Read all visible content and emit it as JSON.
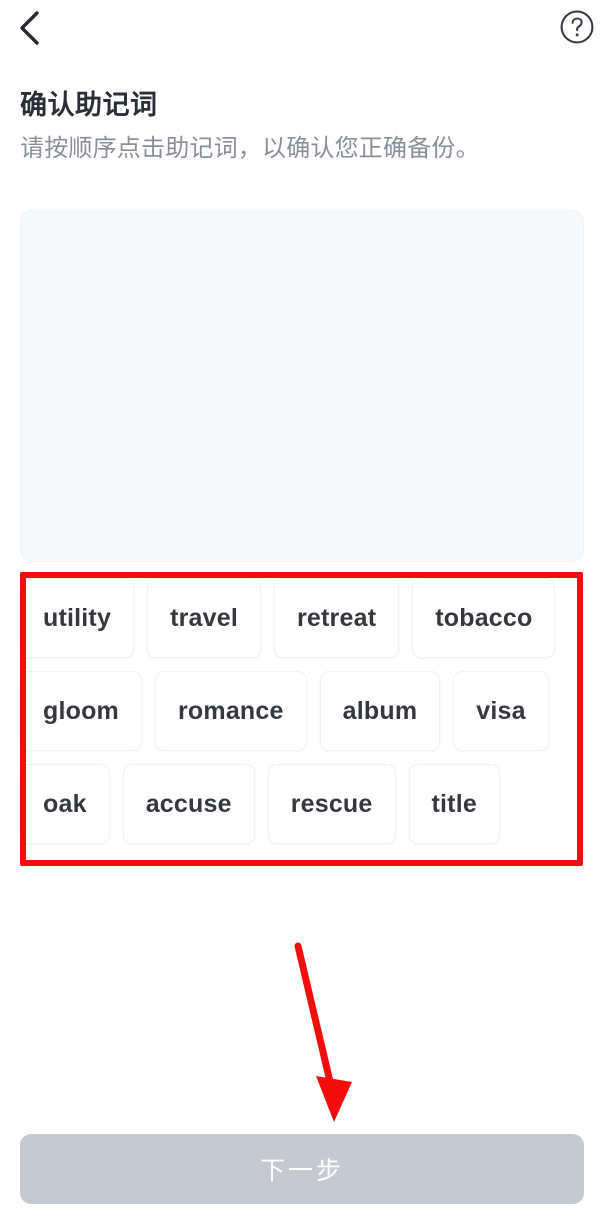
{
  "navbar": {
    "back_icon": "chevron-left-icon",
    "help_icon": "question-mark-circle-icon",
    "help_glyph": "?"
  },
  "header": {
    "title": "确认助记词",
    "subtitle": "请按顺序点击助记词，以确认您正确备份。"
  },
  "answer_panel": {
    "selected_words": [],
    "empty": true
  },
  "word_bank": {
    "rows": [
      [
        "utility",
        "travel",
        "retreat",
        "tobacco"
      ],
      [
        "gloom",
        "romance",
        "album",
        "visa"
      ],
      [
        "oak",
        "accuse",
        "rescue",
        "title"
      ]
    ],
    "words": [
      "utility",
      "travel",
      "retreat",
      "tobacco",
      "gloom",
      "romance",
      "album",
      "visa",
      "oak",
      "accuse",
      "rescue",
      "title"
    ]
  },
  "footer": {
    "next_label": "下一步",
    "next_enabled": false
  },
  "annotations": {
    "box_color": "#f40d0d",
    "arrow_color": "#f40d0d",
    "box_target": "word-bank",
    "arrow_target": "next-button"
  },
  "colors": {
    "title": "#2b2e35",
    "subtitle": "#8b8f99",
    "chip_text": "#35383f",
    "chip_background": "#ffffff",
    "panel_background": "#f5f9fb",
    "button_disabled": "#c5cad2",
    "button_text": "#ffffff",
    "annotation_red": "#f40d0d"
  }
}
